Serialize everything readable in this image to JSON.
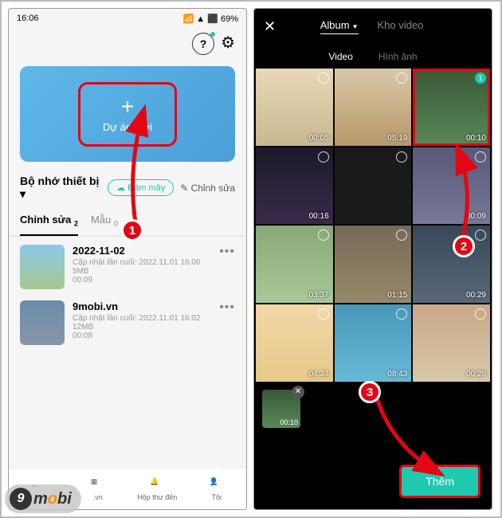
{
  "left": {
    "status": {
      "time": "16:06",
      "bat": "69%"
    },
    "hero": {
      "label": "Dự án mới"
    },
    "storage": "Bộ nhớ thiết bị",
    "cloud": "Đám mây",
    "edit": "Chỉnh sửa",
    "tabs": [
      {
        "label": "Chỉnh sửa",
        "count": "2"
      },
      {
        "label": "Mẫu",
        "count": "0"
      }
    ],
    "items": [
      {
        "title": "2022-11-02",
        "sub": "Cập nhật lần cuối: 2022.11.01 16:06",
        "size": "5MB",
        "dur": "00:09"
      },
      {
        "title": "9mobi.vn",
        "sub": "Cập nhật lần cuối: 2022.11.01 16:02",
        "size": "12MB",
        "dur": "00:08"
      }
    ],
    "nav": [
      ".vn",
      "Hộp thư đến",
      "Tôi"
    ]
  },
  "right": {
    "topTabs": {
      "album": "Album",
      "store": "Kho video"
    },
    "subTabs": {
      "video": "Video",
      "image": "Hình ảnh"
    },
    "cells": [
      {
        "dur": "00:05"
      },
      {
        "dur": "05:19"
      },
      {
        "dur": "00:10",
        "sel": "1"
      },
      {
        "dur": "00:16"
      },
      {
        "dur": ""
      },
      {
        "dur": "00:09"
      },
      {
        "dur": "03:37"
      },
      {
        "dur": "01:15"
      },
      {
        "dur": "00:29"
      },
      {
        "dur": "04:34"
      },
      {
        "dur": "08:43"
      },
      {
        "dur": "00:29"
      }
    ],
    "selected": {
      "dur": "00:10"
    },
    "addBtn": "Thêm"
  },
  "markers": {
    "1": "1",
    "2": "2",
    "3": "3"
  },
  "watermark": "mobi"
}
